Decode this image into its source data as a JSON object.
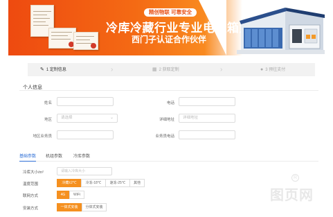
{
  "banner": {
    "tag": "精创物联 可靠安全",
    "title": "冷库冷藏行业专业电控箱定制",
    "subtitle": "西门子认证合作伙伴"
  },
  "steps": [
    {
      "label": "1 定制信息",
      "state": "active"
    },
    {
      "label": "2 获取定制",
      "state": "inactive"
    },
    {
      "label": "3 预往支付",
      "state": "inactive"
    }
  ],
  "personal": {
    "section_title": "个人信息",
    "name_label": "姓名",
    "phone_label": "电话",
    "region_label": "地区",
    "region_placeholder": "请选择",
    "address_label": "详细地址",
    "address_placeholder": "详细地址",
    "agent_label": "地区业务员",
    "agent_phone_label": "业务员电话"
  },
  "tabs": [
    "基础参数",
    "机组参数",
    "冷库参数"
  ],
  "params": {
    "size_label": "冷库大小/m²",
    "size_placeholder": "请输入冷库大小",
    "temp_label": "温度范围",
    "temp_options": [
      "冷藏±2℃",
      "冷冻-18℃",
      "速冻-25℃",
      "其他"
    ],
    "network_label": "联网方式",
    "network_options": [
      "4G",
      "WiFi"
    ],
    "install_label": "安装方式",
    "install_options": [
      "一体式安装",
      "分体式安装"
    ]
  },
  "watermark": {
    "text": "图页网",
    "mark": "R"
  },
  "colors": {
    "accent": "#f5901f",
    "banner": "#ee4a10",
    "tab_active": "#2f6fd6"
  }
}
